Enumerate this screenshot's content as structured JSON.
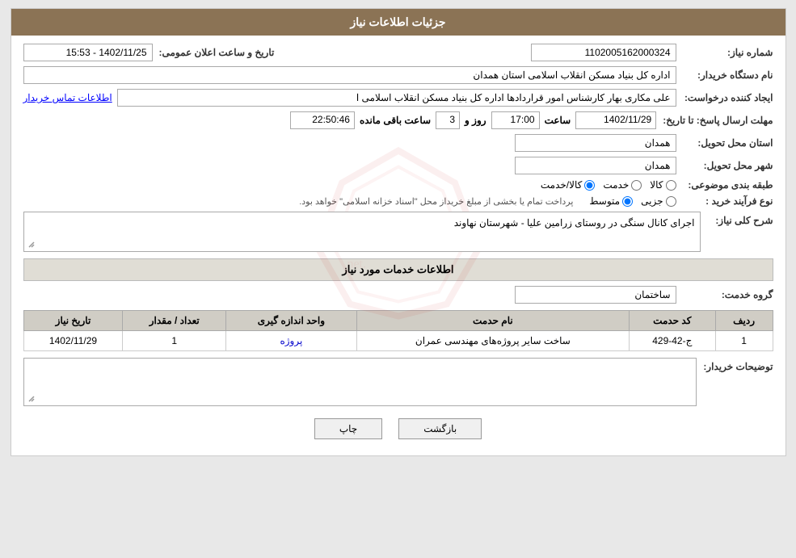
{
  "header": {
    "title": "جزئیات اطلاعات نیاز"
  },
  "labels": {
    "need_number": "شماره نیاز:",
    "buyer_org": "نام دستگاه خریدار:",
    "requester": "ایجاد کننده درخواست:",
    "response_deadline": "مهلت ارسال پاسخ: تا تاریخ:",
    "delivery_province": "استان محل تحویل:",
    "delivery_city": "شهر محل تحویل:",
    "subject_category": "طبقه بندی موضوعی:",
    "procurement_type": "نوع فرآیند خرید :",
    "need_description": "شرح کلی نیاز:",
    "service_info": "اطلاعات خدمات مورد نیاز",
    "service_group": "گروه خدمت:",
    "buyer_desc": "توضیحات خریدار:"
  },
  "values": {
    "need_number": "1102005162000324",
    "announcement_label": "تاریخ و ساعت اعلان عمومی:",
    "announcement_datetime": "1402/11/25 - 15:53",
    "buyer_org": "اداره کل بنیاد مسکن انقلاب اسلامی استان همدان",
    "requester_name": "علی مکاری بهار کارشناس امور قراردادها اداره کل بنیاد مسکن انقلاب اسلامی ا",
    "contact_info_link": "اطلاعات تماس خریدار",
    "deadline_date": "1402/11/29",
    "deadline_time": "17:00",
    "deadline_days": "3",
    "remaining_label": "ساعت باقی مانده",
    "remaining_time": "22:50:46",
    "days_label": "روز و",
    "time_label": "ساعت",
    "delivery_province": "همدان",
    "delivery_city": "همدان",
    "subject_radio1": "کالا",
    "subject_radio2": "خدمت",
    "subject_radio3": "کالا/خدمت",
    "procurement_radio1": "جزیی",
    "procurement_radio2": "متوسط",
    "procurement_notice": "پرداخت تمام یا بخشی از مبلغ خریداز محل \"اسناد خزانه اسلامی\" خواهد بود.",
    "need_description_text": "اجرای کانال سنگی در روستای زرامین علیا - شهرستان نهاوند",
    "service_group_value": "ساختمان",
    "table_headers": [
      "ردیف",
      "کد حدمت",
      "نام حدمت",
      "واحد اندازه گیری",
      "تعداد / مقدار",
      "تاریخ نیاز"
    ],
    "table_rows": [
      {
        "row": "1",
        "service_code": "ج-42-429",
        "service_name": "ساخت سایر پروژه‌های مهندسی عمران",
        "unit": "پروژه",
        "quantity": "1",
        "need_date": "1402/11/29"
      }
    ],
    "buyer_description": ""
  },
  "buttons": {
    "back": "بازگشت",
    "print": "چاپ"
  }
}
